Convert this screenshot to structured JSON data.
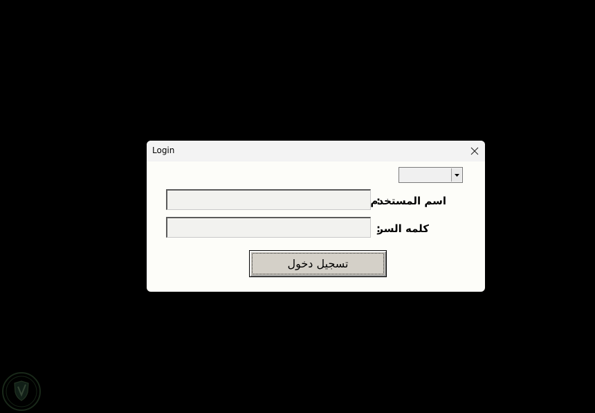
{
  "window": {
    "title": "Login"
  },
  "combo": {
    "selected": ""
  },
  "form": {
    "username_label": "اسم المستخدم",
    "password_label": "كلمه السر",
    "colon": ":",
    "username_value": "",
    "password_value": ""
  },
  "button": {
    "login_label": "تسجيل دخول"
  },
  "icons": {
    "close": "close-icon",
    "dropdown": "dropdown-arrow-icon",
    "watermark": "shield-logo-icon"
  },
  "colors": {
    "desktop_background": "#000000",
    "dialog_background": "#fdfdf9",
    "titlebar_background": "#f3f3f3",
    "button_face": "#d4d0c8",
    "field_background": "#f2f2ef"
  }
}
